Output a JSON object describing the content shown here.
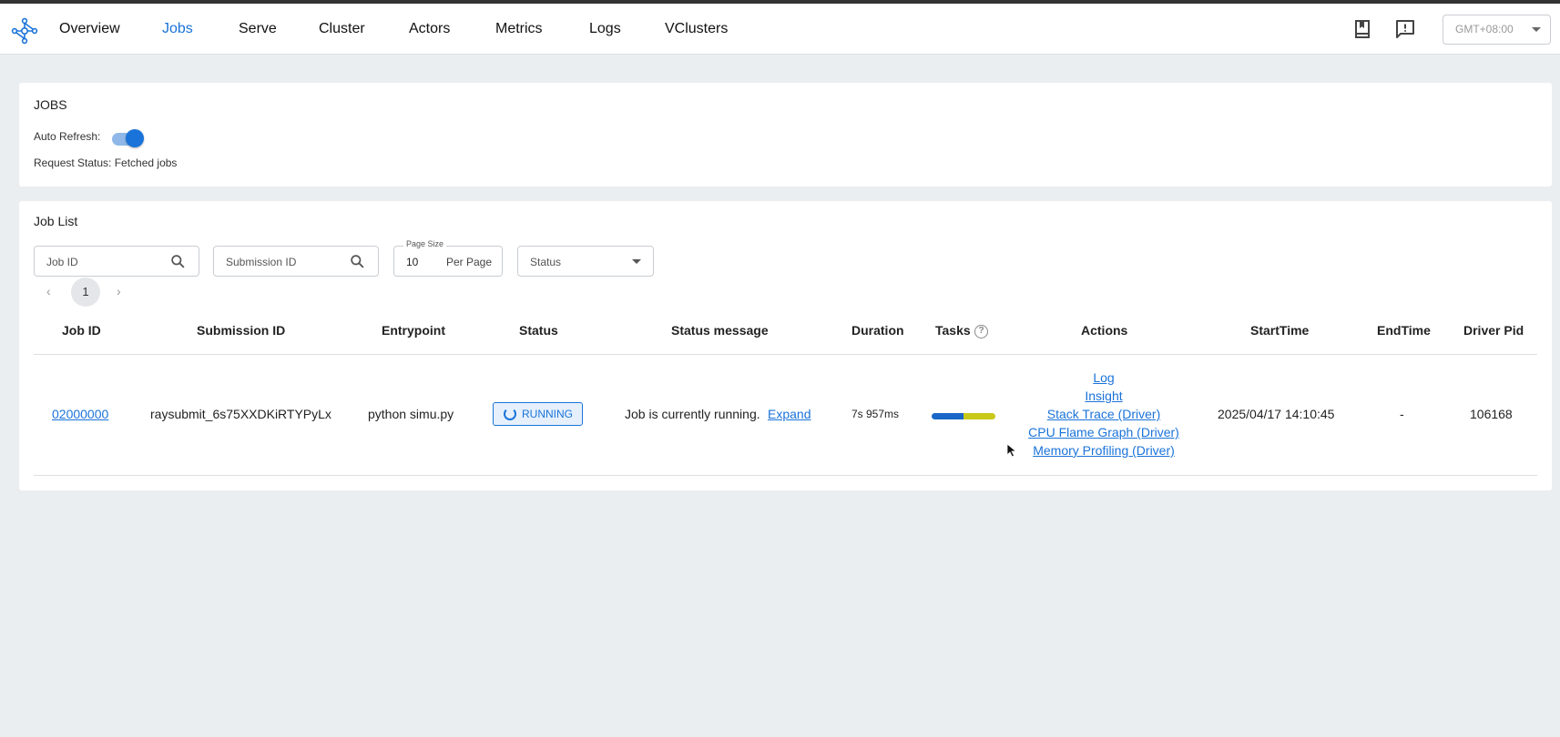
{
  "nav": {
    "items": [
      {
        "label": "Overview",
        "active": false
      },
      {
        "label": "Jobs",
        "active": true
      },
      {
        "label": "Serve",
        "active": false
      },
      {
        "label": "Cluster",
        "active": false
      },
      {
        "label": "Actors",
        "active": false
      },
      {
        "label": "Metrics",
        "active": false
      },
      {
        "label": "Logs",
        "active": false
      },
      {
        "label": "VClusters",
        "active": false
      }
    ],
    "icons": [
      "book-icon",
      "feedback-icon"
    ],
    "timezone": "GMT+08:00"
  },
  "jobs_card": {
    "title": "JOBS",
    "auto_refresh_label": "Auto Refresh:",
    "auto_refresh_on": true,
    "request_status": "Request Status: Fetched jobs"
  },
  "job_list": {
    "title": "Job List",
    "filters": {
      "job_id_placeholder": "Job ID",
      "submission_id_placeholder": "Submission ID",
      "page_size_label": "Page Size",
      "page_size_value": "10",
      "page_size_unit": "Per Page",
      "status_placeholder": "Status"
    },
    "pager": {
      "prev": "‹",
      "page": "1",
      "next": "›"
    },
    "columns": [
      "Job ID",
      "Submission ID",
      "Entrypoint",
      "Status",
      "Status message",
      "Duration",
      "Tasks",
      "Actions",
      "StartTime",
      "EndTime",
      "Driver Pid"
    ],
    "rows": [
      {
        "job_id": "02000000",
        "submission_id": "raysubmit_6s75XXDKiRTYPyLx",
        "entrypoint": "python simu.py",
        "status": "RUNNING",
        "status_message": "Job is currently running.",
        "expand_label": "Expand",
        "duration": "7s 957ms",
        "tasks_running_fraction": 0.5,
        "tasks_pending_fraction": 0.5,
        "actions": [
          "Log",
          "Insight",
          "Stack Trace (Driver)",
          "CPU Flame Graph (Driver)",
          "Memory Profiling (Driver)"
        ],
        "start_time": "2025/04/17 14:10:45",
        "end_time": "-",
        "driver_pid": "106168"
      }
    ]
  },
  "colors": {
    "accent": "#1a73d9",
    "running_segment": "#1a67c8",
    "pending_segment": "#c9c91a"
  }
}
